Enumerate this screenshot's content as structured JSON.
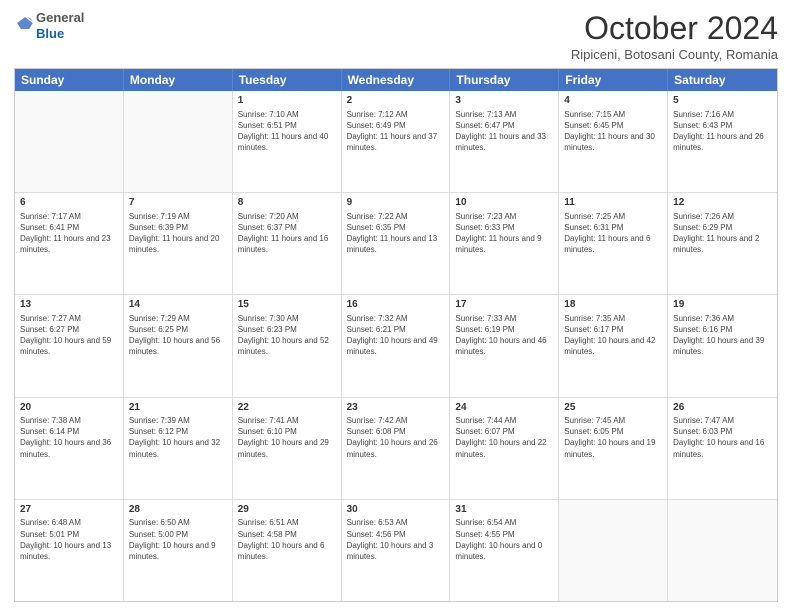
{
  "header": {
    "logo": {
      "line1": "General",
      "line2": "Blue"
    },
    "title": "October 2024",
    "location": "Ripiceni, Botosani County, Romania"
  },
  "calendar": {
    "days_of_week": [
      "Sunday",
      "Monday",
      "Tuesday",
      "Wednesday",
      "Thursday",
      "Friday",
      "Saturday"
    ],
    "rows": [
      [
        {
          "day": "",
          "sunrise": "",
          "sunset": "",
          "daylight": ""
        },
        {
          "day": "",
          "sunrise": "",
          "sunset": "",
          "daylight": ""
        },
        {
          "day": "1",
          "sunrise": "Sunrise: 7:10 AM",
          "sunset": "Sunset: 6:51 PM",
          "daylight": "Daylight: 11 hours and 40 minutes."
        },
        {
          "day": "2",
          "sunrise": "Sunrise: 7:12 AM",
          "sunset": "Sunset: 6:49 PM",
          "daylight": "Daylight: 11 hours and 37 minutes."
        },
        {
          "day": "3",
          "sunrise": "Sunrise: 7:13 AM",
          "sunset": "Sunset: 6:47 PM",
          "daylight": "Daylight: 11 hours and 33 minutes."
        },
        {
          "day": "4",
          "sunrise": "Sunrise: 7:15 AM",
          "sunset": "Sunset: 6:45 PM",
          "daylight": "Daylight: 11 hours and 30 minutes."
        },
        {
          "day": "5",
          "sunrise": "Sunrise: 7:16 AM",
          "sunset": "Sunset: 6:43 PM",
          "daylight": "Daylight: 11 hours and 26 minutes."
        }
      ],
      [
        {
          "day": "6",
          "sunrise": "Sunrise: 7:17 AM",
          "sunset": "Sunset: 6:41 PM",
          "daylight": "Daylight: 11 hours and 23 minutes."
        },
        {
          "day": "7",
          "sunrise": "Sunrise: 7:19 AM",
          "sunset": "Sunset: 6:39 PM",
          "daylight": "Daylight: 11 hours and 20 minutes."
        },
        {
          "day": "8",
          "sunrise": "Sunrise: 7:20 AM",
          "sunset": "Sunset: 6:37 PM",
          "daylight": "Daylight: 11 hours and 16 minutes."
        },
        {
          "day": "9",
          "sunrise": "Sunrise: 7:22 AM",
          "sunset": "Sunset: 6:35 PM",
          "daylight": "Daylight: 11 hours and 13 minutes."
        },
        {
          "day": "10",
          "sunrise": "Sunrise: 7:23 AM",
          "sunset": "Sunset: 6:33 PM",
          "daylight": "Daylight: 11 hours and 9 minutes."
        },
        {
          "day": "11",
          "sunrise": "Sunrise: 7:25 AM",
          "sunset": "Sunset: 6:31 PM",
          "daylight": "Daylight: 11 hours and 6 minutes."
        },
        {
          "day": "12",
          "sunrise": "Sunrise: 7:26 AM",
          "sunset": "Sunset: 6:29 PM",
          "daylight": "Daylight: 11 hours and 2 minutes."
        }
      ],
      [
        {
          "day": "13",
          "sunrise": "Sunrise: 7:27 AM",
          "sunset": "Sunset: 6:27 PM",
          "daylight": "Daylight: 10 hours and 59 minutes."
        },
        {
          "day": "14",
          "sunrise": "Sunrise: 7:29 AM",
          "sunset": "Sunset: 6:25 PM",
          "daylight": "Daylight: 10 hours and 56 minutes."
        },
        {
          "day": "15",
          "sunrise": "Sunrise: 7:30 AM",
          "sunset": "Sunset: 6:23 PM",
          "daylight": "Daylight: 10 hours and 52 minutes."
        },
        {
          "day": "16",
          "sunrise": "Sunrise: 7:32 AM",
          "sunset": "Sunset: 6:21 PM",
          "daylight": "Daylight: 10 hours and 49 minutes."
        },
        {
          "day": "17",
          "sunrise": "Sunrise: 7:33 AM",
          "sunset": "Sunset: 6:19 PM",
          "daylight": "Daylight: 10 hours and 46 minutes."
        },
        {
          "day": "18",
          "sunrise": "Sunrise: 7:35 AM",
          "sunset": "Sunset: 6:17 PM",
          "daylight": "Daylight: 10 hours and 42 minutes."
        },
        {
          "day": "19",
          "sunrise": "Sunrise: 7:36 AM",
          "sunset": "Sunset: 6:16 PM",
          "daylight": "Daylight: 10 hours and 39 minutes."
        }
      ],
      [
        {
          "day": "20",
          "sunrise": "Sunrise: 7:38 AM",
          "sunset": "Sunset: 6:14 PM",
          "daylight": "Daylight: 10 hours and 36 minutes."
        },
        {
          "day": "21",
          "sunrise": "Sunrise: 7:39 AM",
          "sunset": "Sunset: 6:12 PM",
          "daylight": "Daylight: 10 hours and 32 minutes."
        },
        {
          "day": "22",
          "sunrise": "Sunrise: 7:41 AM",
          "sunset": "Sunset: 6:10 PM",
          "daylight": "Daylight: 10 hours and 29 minutes."
        },
        {
          "day": "23",
          "sunrise": "Sunrise: 7:42 AM",
          "sunset": "Sunset: 6:08 PM",
          "daylight": "Daylight: 10 hours and 26 minutes."
        },
        {
          "day": "24",
          "sunrise": "Sunrise: 7:44 AM",
          "sunset": "Sunset: 6:07 PM",
          "daylight": "Daylight: 10 hours and 22 minutes."
        },
        {
          "day": "25",
          "sunrise": "Sunrise: 7:45 AM",
          "sunset": "Sunset: 6:05 PM",
          "daylight": "Daylight: 10 hours and 19 minutes."
        },
        {
          "day": "26",
          "sunrise": "Sunrise: 7:47 AM",
          "sunset": "Sunset: 6:03 PM",
          "daylight": "Daylight: 10 hours and 16 minutes."
        }
      ],
      [
        {
          "day": "27",
          "sunrise": "Sunrise: 6:48 AM",
          "sunset": "Sunset: 5:01 PM",
          "daylight": "Daylight: 10 hours and 13 minutes."
        },
        {
          "day": "28",
          "sunrise": "Sunrise: 6:50 AM",
          "sunset": "Sunset: 5:00 PM",
          "daylight": "Daylight: 10 hours and 9 minutes."
        },
        {
          "day": "29",
          "sunrise": "Sunrise: 6:51 AM",
          "sunset": "Sunset: 4:58 PM",
          "daylight": "Daylight: 10 hours and 6 minutes."
        },
        {
          "day": "30",
          "sunrise": "Sunrise: 6:53 AM",
          "sunset": "Sunset: 4:56 PM",
          "daylight": "Daylight: 10 hours and 3 minutes."
        },
        {
          "day": "31",
          "sunrise": "Sunrise: 6:54 AM",
          "sunset": "Sunset: 4:55 PM",
          "daylight": "Daylight: 10 hours and 0 minutes."
        },
        {
          "day": "",
          "sunrise": "",
          "sunset": "",
          "daylight": ""
        },
        {
          "day": "",
          "sunrise": "",
          "sunset": "",
          "daylight": ""
        }
      ]
    ]
  }
}
